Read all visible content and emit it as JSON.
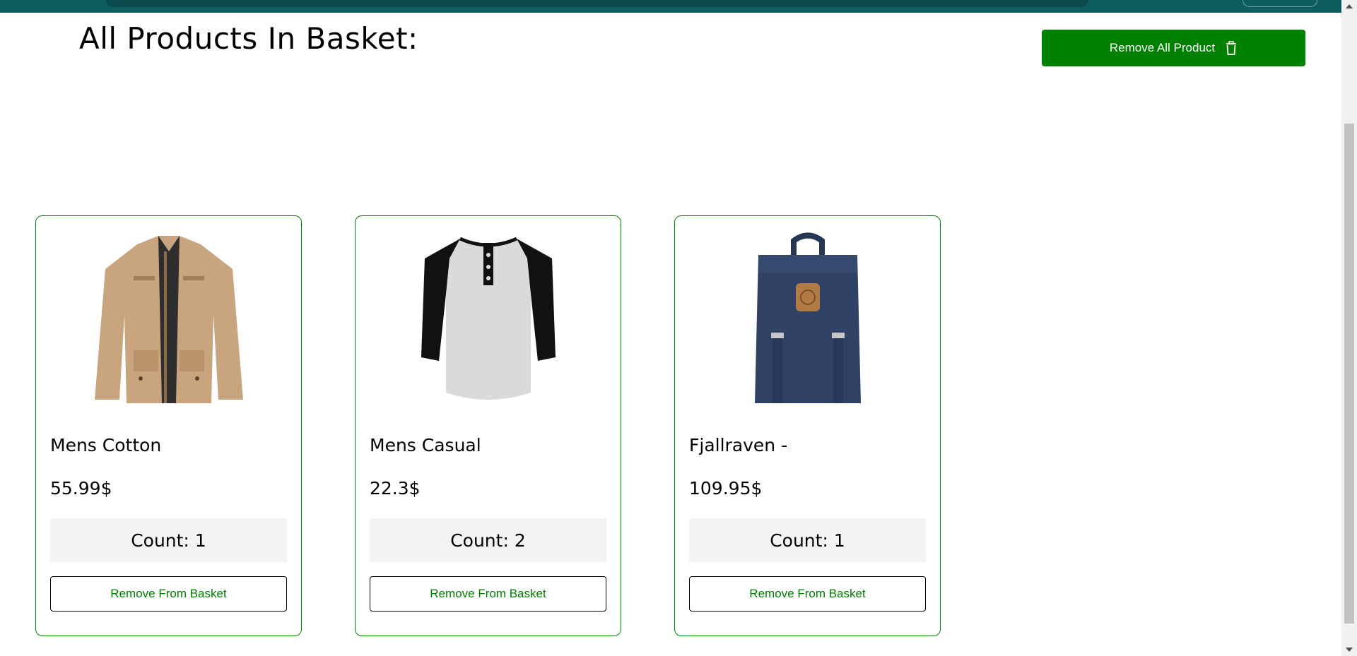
{
  "header": {
    "title": "All Products In Basket:",
    "remove_all_label": "Remove All Product",
    "remove_all_icon": "trash-icon"
  },
  "colors": {
    "accent": "#008000",
    "navbar": "#0d5c5e",
    "count_bg": "#f4f2f2"
  },
  "products": [
    {
      "name": "Mens Cotton",
      "price": "55.99$",
      "count_label": "Count:",
      "count": "1",
      "remove_label": "Remove From Basket",
      "image": "jacket-image"
    },
    {
      "name": "Mens Casual",
      "price": "22.3$",
      "count_label": "Count:",
      "count": "2",
      "remove_label": "Remove From Basket",
      "image": "henley-shirt-image"
    },
    {
      "name": "Fjallraven -",
      "price": "109.95$",
      "count_label": "Count:",
      "count": "1",
      "remove_label": "Remove From Basket",
      "image": "backpack-image"
    }
  ]
}
